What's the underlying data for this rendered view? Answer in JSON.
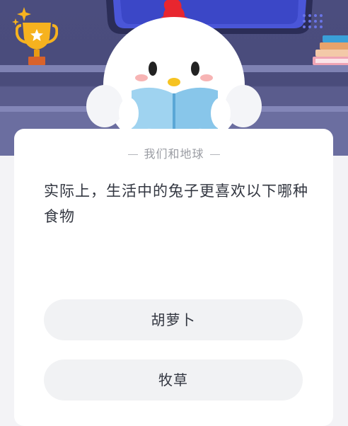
{
  "header": {
    "subtitle": "我们和地球"
  },
  "question": {
    "text": "实际上，生活中的兔子更喜欢以下哪种食物"
  },
  "options": [
    {
      "label": "胡萝卜"
    },
    {
      "label": "牧草"
    }
  ],
  "icons": [
    "trophy-icon",
    "sparkle-icon",
    "chick-mascot",
    "books-icon",
    "window-frame"
  ],
  "colors": {
    "background_scene": "#4b4d7e",
    "card": "#ffffff",
    "option_bg": "#f1f2f4",
    "text_primary": "#333741",
    "text_secondary": "#9a9ca3",
    "trophy_gold": "#f6b21f",
    "crest_red": "#e8262f",
    "book_blue": "#9fd3f0"
  }
}
